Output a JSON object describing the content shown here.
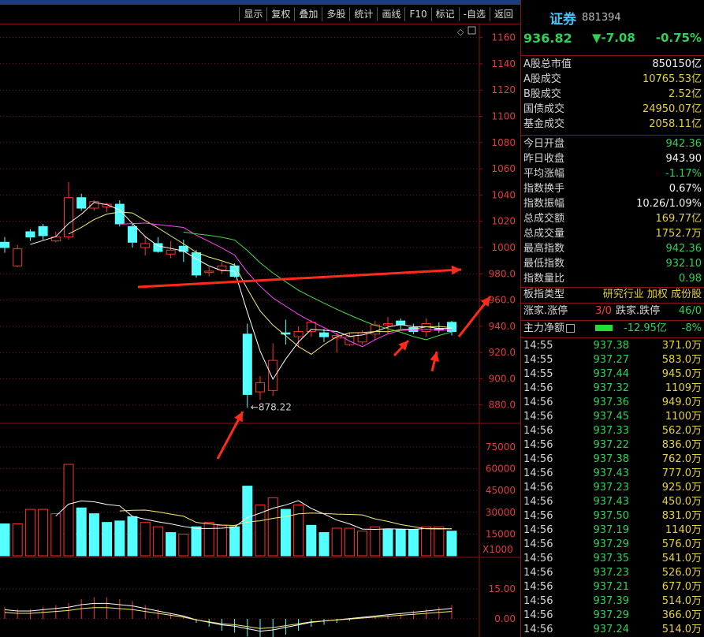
{
  "toolbar": {
    "items": [
      "显示",
      "复权",
      "叠加",
      "多股",
      "统计",
      "画线",
      "F10",
      "标记",
      "-自选",
      "返回"
    ]
  },
  "stock": {
    "name": "证券",
    "code": "881394",
    "price": "936.82",
    "change": "▼-7.08",
    "change_pct": "-0.75%"
  },
  "market": [
    {
      "label": "A股总市值",
      "value": "850150亿"
    },
    {
      "label": "A股成交",
      "value": "10765.53亿"
    },
    {
      "label": "B股成交",
      "value": "2.52亿"
    },
    {
      "label": "国债成交",
      "value": "24950.07亿"
    },
    {
      "label": "基金成交",
      "value": "2058.11亿"
    }
  ],
  "stats": [
    {
      "label": "今日开盘",
      "value": "942.36",
      "color": "#2ed158"
    },
    {
      "label": "昨日收盘",
      "value": "943.90",
      "color": "#f2f2f2"
    },
    {
      "label": "平均涨幅",
      "value": "-1.17%",
      "color": "#2ed158"
    },
    {
      "label": "指数换手",
      "value": "0.67%",
      "color": "#f2f2f2"
    },
    {
      "label": "指数振幅",
      "value": "10.26/1.09%",
      "color": "#f2f2f2"
    },
    {
      "label": "总成交额",
      "value": "169.77亿",
      "color": "#e6d23c"
    },
    {
      "label": "总成交量",
      "value": "1752.7万",
      "color": "#e6d23c"
    },
    {
      "label": "最高指数",
      "value": "942.36",
      "color": "#2ed158"
    },
    {
      "label": "最低指数",
      "value": "932.10",
      "color": "#2ed158"
    },
    {
      "label": "指数量比",
      "value": "0.98",
      "color": "#2ed158"
    }
  ],
  "index_type": {
    "label": "板指类型",
    "value": "研究行业 加权 成份股"
  },
  "updown": {
    "label": "涨家.涨停",
    "up": "3/0",
    "label2": "跌家.跌停",
    "down": "46/0"
  },
  "netflow": {
    "label": "主力净额",
    "value": "-12.95亿",
    "pct": "-8%"
  },
  "ticks": [
    {
      "time": "14:55",
      "price": "937.38",
      "vol": "371.0万"
    },
    {
      "time": "14:55",
      "price": "937.27",
      "vol": "583.0万"
    },
    {
      "time": "14:55",
      "price": "937.44",
      "vol": "945.0万"
    },
    {
      "time": "14:56",
      "price": "937.32",
      "vol": "1109万"
    },
    {
      "time": "14:56",
      "price": "937.36",
      "vol": "949.0万"
    },
    {
      "time": "14:56",
      "price": "937.45",
      "vol": "1100万"
    },
    {
      "time": "14:56",
      "price": "937.33",
      "vol": "562.0万"
    },
    {
      "time": "14:56",
      "price": "937.22",
      "vol": "836.0万"
    },
    {
      "time": "14:56",
      "price": "937.38",
      "vol": "762.0万"
    },
    {
      "time": "14:56",
      "price": "937.43",
      "vol": "777.0万"
    },
    {
      "time": "14:56",
      "price": "937.23",
      "vol": "925.0万"
    },
    {
      "time": "14:56",
      "price": "937.43",
      "vol": "450.0万"
    },
    {
      "time": "14:56",
      "price": "937.50",
      "vol": "831.0万"
    },
    {
      "time": "14:56",
      "price": "937.19",
      "vol": "1140万"
    },
    {
      "time": "14:56",
      "price": "937.29",
      "vol": "576.0万"
    },
    {
      "time": "14:56",
      "price": "937.35",
      "vol": "541.0万"
    },
    {
      "time": "14:56",
      "price": "937.23",
      "vol": "526.0万"
    },
    {
      "time": "14:56",
      "price": "937.21",
      "vol": "677.0万"
    },
    {
      "time": "14:56",
      "price": "937.39",
      "vol": "514.0万"
    },
    {
      "time": "14:56",
      "price": "937.29",
      "vol": "366.0万"
    },
    {
      "time": "14:56",
      "price": "937.24",
      "vol": "514.0万"
    }
  ],
  "chart": {
    "price_axis": [
      "1160",
      "1140",
      "1120",
      "1100",
      "1080",
      "1060",
      "1040",
      "1020",
      "1000",
      "980.0",
      "960.0",
      "940.0",
      "920.0",
      "900.0",
      "880.0"
    ],
    "volume_axis": [
      "75000",
      "60000",
      "45000",
      "30000",
      "15000"
    ],
    "volume_unit": "X1000",
    "macd_axis": [
      "15.00",
      "0.00"
    ],
    "low_label": "←878.22",
    "colors": {
      "up": "#ff3030",
      "down": "#54ffff",
      "ma5": "#ffffff",
      "ma10": "#f4ee7a",
      "ma20": "#ff44ff",
      "ma30": "#44dd44",
      "arrow": "#ff2a1a"
    }
  },
  "chart_data": {
    "type": "candlestick",
    "candles": [
      {
        "o": 1004,
        "c": 1000,
        "h": 1008,
        "l": 996
      },
      {
        "o": 986,
        "c": 999,
        "h": 1002,
        "l": 985
      },
      {
        "o": 1012,
        "c": 1008,
        "h": 1014,
        "l": 1005
      },
      {
        "o": 1016,
        "c": 1009,
        "h": 1018,
        "l": 1006
      },
      {
        "o": 1005,
        "c": 1008,
        "h": 1012,
        "l": 1004
      },
      {
        "o": 1008,
        "c": 1038,
        "h": 1050,
        "l": 1006
      },
      {
        "o": 1038,
        "c": 1030,
        "h": 1041,
        "l": 1028
      },
      {
        "o": 1030,
        "c": 1035,
        "h": 1036,
        "l": 1028
      },
      {
        "o": 1031,
        "c": 1033,
        "h": 1034,
        "l": 1027
      },
      {
        "o": 1033,
        "c": 1018,
        "h": 1036,
        "l": 1016
      },
      {
        "o": 1016,
        "c": 1004,
        "h": 1018,
        "l": 1000
      },
      {
        "o": 1000,
        "c": 1003,
        "h": 1008,
        "l": 994
      },
      {
        "o": 1003,
        "c": 997,
        "h": 1008,
        "l": 996
      },
      {
        "o": 995,
        "c": 998,
        "h": 1005,
        "l": 992
      },
      {
        "o": 1001,
        "c": 997,
        "h": 1006,
        "l": 989
      },
      {
        "o": 996,
        "c": 979,
        "h": 998,
        "l": 977
      },
      {
        "o": 981,
        "c": 982,
        "h": 985,
        "l": 978
      },
      {
        "o": 983,
        "c": 986,
        "h": 989,
        "l": 980
      },
      {
        "o": 986,
        "c": 978,
        "h": 988,
        "l": 977
      },
      {
        "o": 934,
        "c": 888,
        "h": 942,
        "l": 878
      },
      {
        "o": 890,
        "c": 897,
        "h": 902,
        "l": 884
      },
      {
        "o": 891,
        "c": 914,
        "h": 927,
        "l": 887
      },
      {
        "o": 935,
        "c": 934,
        "h": 945,
        "l": 926
      },
      {
        "o": 932,
        "c": 936,
        "h": 940,
        "l": 924
      },
      {
        "o": 936,
        "c": 943,
        "h": 945,
        "l": 932
      },
      {
        "o": 935,
        "c": 932,
        "h": 938,
        "l": 928
      },
      {
        "o": 931,
        "c": 933,
        "h": 935,
        "l": 920
      },
      {
        "o": 926,
        "c": 932,
        "h": 935,
        "l": 925
      },
      {
        "o": 928,
        "c": 935,
        "h": 937,
        "l": 926
      },
      {
        "o": 934,
        "c": 941,
        "h": 944,
        "l": 930
      },
      {
        "o": 941,
        "c": 942,
        "h": 947,
        "l": 934
      },
      {
        "o": 944,
        "c": 941,
        "h": 946,
        "l": 938
      },
      {
        "o": 939,
        "c": 936,
        "h": 942,
        "l": 934
      },
      {
        "o": 936,
        "c": 942,
        "h": 946,
        "l": 932
      },
      {
        "o": 938,
        "c": 937,
        "h": 943,
        "l": 935
      },
      {
        "o": 943,
        "c": 936,
        "h": 944,
        "l": 933
      }
    ],
    "volume": [
      {
        "v": 22000,
        "up": false
      },
      {
        "v": 22000,
        "up": true
      },
      {
        "v": 32000,
        "up": true
      },
      {
        "v": 32000,
        "up": true
      },
      {
        "v": 29000,
        "up": true
      },
      {
        "v": 63000,
        "up": true
      },
      {
        "v": 33000,
        "up": false
      },
      {
        "v": 29000,
        "up": false
      },
      {
        "v": 23000,
        "up": false
      },
      {
        "v": 24000,
        "up": false
      },
      {
        "v": 27000,
        "up": false
      },
      {
        "v": 23000,
        "up": true
      },
      {
        "v": 20000,
        "up": true
      },
      {
        "v": 16000,
        "up": false
      },
      {
        "v": 15000,
        "up": true
      },
      {
        "v": 20000,
        "up": false
      },
      {
        "v": 23000,
        "up": true
      },
      {
        "v": 21000,
        "up": true
      },
      {
        "v": 20000,
        "up": false
      },
      {
        "v": 48000,
        "up": false
      },
      {
        "v": 35000,
        "up": true
      },
      {
        "v": 40000,
        "up": true
      },
      {
        "v": 32000,
        "up": false
      },
      {
        "v": 35000,
        "up": true
      },
      {
        "v": 21000,
        "up": false
      },
      {
        "v": 16000,
        "up": false
      },
      {
        "v": 19000,
        "up": true
      },
      {
        "v": 19000,
        "up": true
      },
      {
        "v": 17000,
        "up": true
      },
      {
        "v": 20000,
        "up": true
      },
      {
        "v": 18000,
        "up": false
      },
      {
        "v": 18000,
        "up": false
      },
      {
        "v": 18000,
        "up": false
      },
      {
        "v": 20000,
        "up": true
      },
      {
        "v": 20000,
        "up": true
      },
      {
        "v": 17000,
        "up": false
      }
    ],
    "ylim": [
      866,
      1170
    ],
    "volume_lim": [
      0,
      88000
    ]
  }
}
